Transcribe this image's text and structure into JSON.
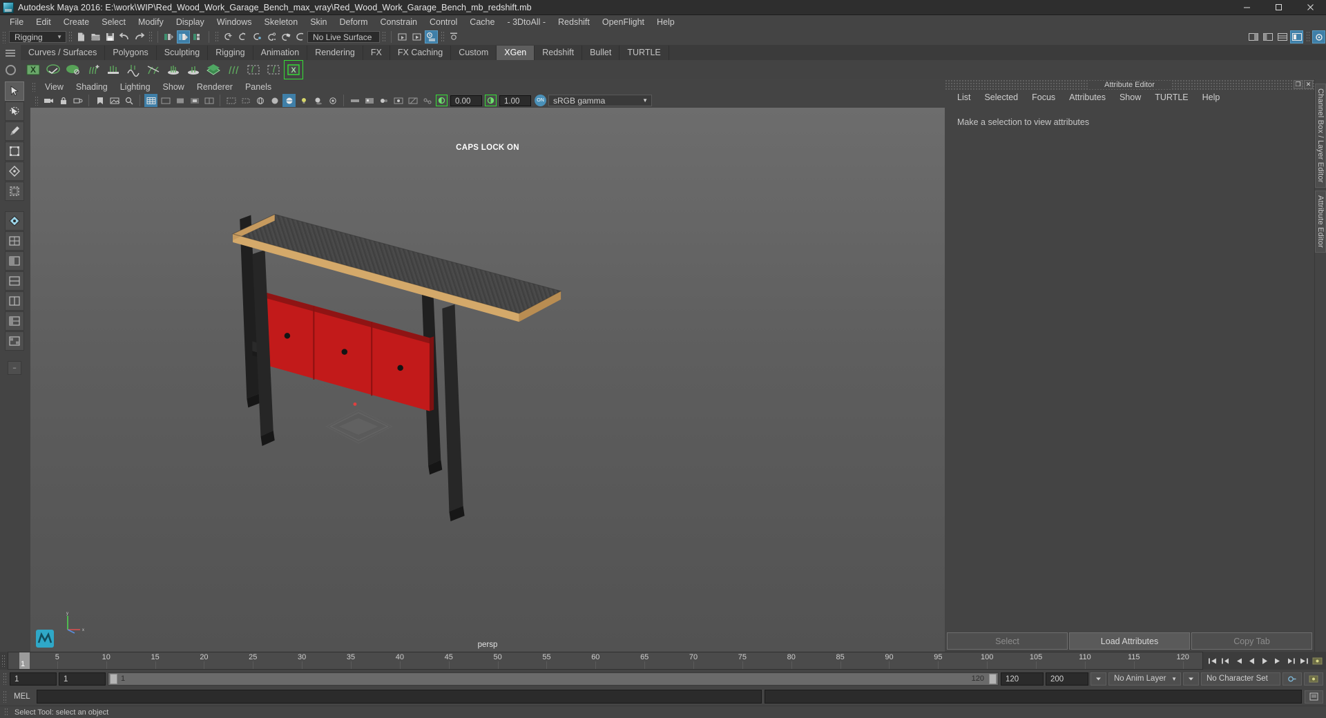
{
  "window": {
    "title": "Autodesk Maya 2016: E:\\work\\WIP\\Red_Wood_Work_Garage_Bench_max_vray\\Red_Wood_Work_Garage_Bench_mb_redshift.mb",
    "app_icon": "maya-icon",
    "minimize": "–",
    "maximize": "□",
    "close": "✕"
  },
  "menubar": {
    "items": [
      {
        "label": "File"
      },
      {
        "label": "Edit"
      },
      {
        "label": "Create"
      },
      {
        "label": "Select"
      },
      {
        "label": "Modify"
      },
      {
        "label": "Display"
      },
      {
        "label": "Windows"
      },
      {
        "label": "Skeleton"
      },
      {
        "label": "Skin"
      },
      {
        "label": "Deform"
      },
      {
        "label": "Constrain"
      },
      {
        "label": "Control"
      },
      {
        "label": "Cache"
      },
      {
        "label": "- 3DtoAll -"
      },
      {
        "label": "Redshift"
      },
      {
        "label": "OpenFlight"
      },
      {
        "label": "Help"
      }
    ]
  },
  "toolbar": {
    "menu_set": "Rigging",
    "live_surface": "No Live Surface",
    "icons": [
      "new-scene-icon",
      "open-scene-icon",
      "save-scene-icon",
      "undo-icon",
      "redo-icon",
      "select-by-hierarchy-icon",
      "select-by-object-icon",
      "select-by-component-icon",
      "snap-to-grid-icon",
      "snap-to-curve-icon",
      "snap-to-point-icon",
      "snap-to-projected-center-icon",
      "snap-to-view-plane-icon",
      "make-live-icon",
      "open-render-view-icon",
      "render-current-frame-icon",
      "ipr-render-icon",
      "render-settings-icon",
      "toggle-sidebar-icon",
      "attribute-editor-icon",
      "channel-box-icon",
      "tool-settings-icon"
    ]
  },
  "shelf": {
    "tabs": [
      {
        "label": "Curves / Surfaces",
        "active": false
      },
      {
        "label": "Polygons",
        "active": false
      },
      {
        "label": "Sculpting",
        "active": false
      },
      {
        "label": "Rigging",
        "active": false
      },
      {
        "label": "Animation",
        "active": false
      },
      {
        "label": "Rendering",
        "active": false
      },
      {
        "label": "FX",
        "active": false
      },
      {
        "label": "FX Caching",
        "active": false
      },
      {
        "label": "Custom",
        "active": false
      },
      {
        "label": "XGen",
        "active": true
      },
      {
        "label": "Redshift",
        "active": false
      },
      {
        "label": "Bullet",
        "active": false
      },
      {
        "label": "TURTLE",
        "active": false
      }
    ],
    "icons": [
      "xgen-editor-icon",
      "xgen-sphere-wire-icon",
      "xgen-sphere-solid-icon",
      "xgen-add-guide-icon",
      "xgen-clump-icon",
      "xgen-noise-icon",
      "xgen-cut-icon",
      "xgen-density-icon",
      "xgen-region-icon",
      "xgen-patch-icon",
      "xgen-grooming-icon",
      "xgen-preview-icon",
      "xgen-archive-icon",
      "xgen-export-icon"
    ]
  },
  "toolbox": {
    "items": [
      {
        "name": "select-tool-icon",
        "active": true
      },
      {
        "name": "lasso-select-tool-icon",
        "active": false
      },
      {
        "name": "paint-select-tool-icon",
        "active": false
      },
      {
        "name": "move-tool-icon",
        "active": false
      },
      {
        "name": "rotate-tool-icon",
        "active": false
      },
      {
        "name": "scale-tool-icon",
        "active": false
      },
      {
        "name": "last-tool-icon",
        "active": false
      },
      {
        "name": "single-view-layout-icon",
        "active": false
      },
      {
        "name": "four-view-layout-icon",
        "active": false
      },
      {
        "name": "two-stacked-layout-icon",
        "active": false
      },
      {
        "name": "two-side-layout-icon",
        "active": false
      },
      {
        "name": "persp-outliner-layout-icon",
        "active": false
      },
      {
        "name": "hypergraph-layout-icon",
        "active": false
      },
      {
        "name": "more-layouts-icon",
        "active": false
      }
    ]
  },
  "viewport": {
    "menu": [
      {
        "label": "View"
      },
      {
        "label": "Shading"
      },
      {
        "label": "Lighting"
      },
      {
        "label": "Show"
      },
      {
        "label": "Renderer"
      },
      {
        "label": "Panels"
      }
    ],
    "exposure": "0.00",
    "gamma": "1.00",
    "color_management": "sRGB gamma",
    "caps_lock_message": "CAPS LOCK ON",
    "camera_label": "persp",
    "axis_labels": {
      "x": "x",
      "y": "y",
      "z": "z"
    },
    "tool_icons": [
      "select-camera-icon",
      "lock-camera-icon",
      "camera-attributes-icon",
      "bookmark-icon",
      "image-plane-icon",
      "two-dim-pan-zoom-icon",
      "grid-toggle-icon",
      "film-gate-icon",
      "resolution-gate-icon",
      "gate-mask-icon",
      "film-origin-icon",
      "safe-action-icon",
      "safe-title-icon",
      "field-chart-icon",
      "wireframe-icon",
      "smooth-shade-all-icon",
      "shaded-wireframe-icon",
      "use-all-lights-icon",
      "shadows-icon",
      "screen-space-ao-icon",
      "motion-blur-icon",
      "multisample-aa-icon",
      "depth-of-field-icon",
      "isolate-select-icon",
      "xray-icon",
      "xray-joints-icon",
      "exposure-icon",
      "gamma-icon",
      "color-management-toggle-icon"
    ]
  },
  "attribute_editor": {
    "panel_title": "Attribute Editor",
    "restore_icon": "restore-icon",
    "close_icon": "close-icon",
    "menu": [
      {
        "label": "List"
      },
      {
        "label": "Selected"
      },
      {
        "label": "Focus"
      },
      {
        "label": "Attributes"
      },
      {
        "label": "Show"
      },
      {
        "label": "TURTLE"
      },
      {
        "label": "Help"
      }
    ],
    "empty_message": "Make a selection to view attributes",
    "buttons": [
      {
        "label": "Select",
        "enabled": false
      },
      {
        "label": "Load Attributes",
        "enabled": true
      },
      {
        "label": "Copy Tab",
        "enabled": false
      }
    ]
  },
  "right_rail": {
    "tabs": [
      {
        "label": "Channel Box / Layer Editor"
      },
      {
        "label": "Attribute Editor"
      }
    ]
  },
  "timeline": {
    "current_frame": "1",
    "ticks": [
      5,
      10,
      15,
      20,
      25,
      30,
      35,
      40,
      45,
      50,
      55,
      60,
      65,
      70,
      75,
      80,
      85,
      90,
      95,
      100,
      105,
      110,
      115,
      120
    ],
    "playback_icons": [
      "go-to-start-icon",
      "step-back-key-icon",
      "step-back-frame-icon",
      "play-backwards-icon",
      "play-forwards-icon",
      "step-forward-frame-icon",
      "step-forward-key-icon",
      "go-to-end-icon"
    ]
  },
  "range": {
    "anim_start": "1",
    "range_start": "1",
    "slider_start": "1",
    "slider_end": "120",
    "range_end": "120",
    "anim_end": "200",
    "anim_layer": "No Anim Layer",
    "character_set": "No Character Set",
    "auto_key_icon": "auto-key-icon",
    "anim_prefs_icon": "animation-preferences-icon"
  },
  "command_line": {
    "language": "MEL",
    "input_value": "",
    "input_placeholder": ""
  },
  "status": {
    "message": "Select Tool: select an object"
  },
  "colors": {
    "accent_blue": "#3f7fa8",
    "shelf_active": "#5e5e5e",
    "bench_red": "#c21a1a",
    "bench_wood": "#d4a96a",
    "bench_metal": "#2b2b2b",
    "green_highlight": "#35e035",
    "panel_bg": "#444444"
  }
}
